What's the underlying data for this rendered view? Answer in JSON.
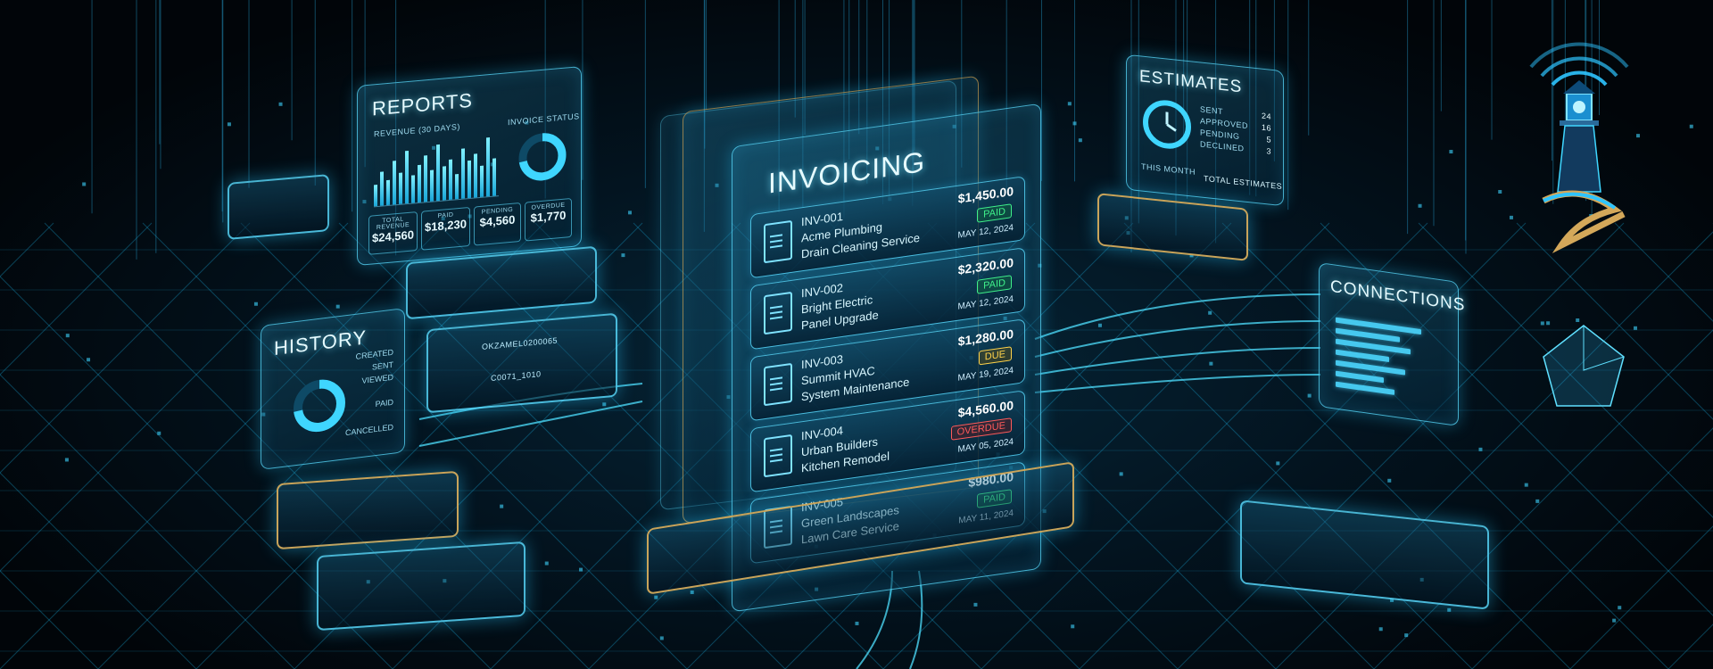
{
  "reports": {
    "title": "REPORTS",
    "revenue_label": "REVENUE (30 DAYS)",
    "status_label": "INVOICE STATUS",
    "bars": [
      0.35,
      0.55,
      0.4,
      0.7,
      0.5,
      0.85,
      0.45,
      0.6,
      0.75,
      0.5,
      0.9,
      0.55,
      0.65,
      0.4,
      0.8,
      0.6,
      0.7,
      0.5,
      0.95,
      0.6
    ],
    "stats": [
      {
        "label": "TOTAL REVENUE",
        "value": "$24,560"
      },
      {
        "label": "PAID",
        "value": "$18,230"
      },
      {
        "label": "PENDING",
        "value": "$4,560"
      },
      {
        "label": "OVERDUE",
        "value": "$1,770"
      }
    ]
  },
  "history": {
    "title": "HISTORY",
    "items": [
      "CREATED",
      "SENT",
      "VIEWED",
      "",
      "PAID",
      "",
      "CANCELLED"
    ]
  },
  "invoicing": {
    "title": "INVOICING",
    "invoices": [
      {
        "id": "INV-001",
        "client": "Acme Plumbing",
        "desc": "Drain Cleaning Service",
        "amount": "$1,450.00",
        "status": "PAID",
        "status_type": "paid",
        "date": "MAY 12, 2024"
      },
      {
        "id": "INV-002",
        "client": "Bright Electric",
        "desc": "Panel Upgrade",
        "amount": "$2,320.00",
        "status": "PAID",
        "status_type": "paid",
        "date": "MAY 12, 2024"
      },
      {
        "id": "INV-003",
        "client": "Summit HVAC",
        "desc": "System Maintenance",
        "amount": "$1,280.00",
        "status": "DUE",
        "status_type": "due",
        "date": "MAY 19, 2024"
      },
      {
        "id": "INV-004",
        "client": "Urban Builders",
        "desc": "Kitchen Remodel",
        "amount": "$4,560.00",
        "status": "OVERDUE",
        "status_type": "overdue",
        "date": "MAY 05, 2024"
      },
      {
        "id": "INV-005",
        "client": "Green Landscapes",
        "desc": "Lawn Care Service",
        "amount": "$980.00",
        "status": "PAID",
        "status_type": "paid",
        "date": "MAY 11, 2024"
      }
    ]
  },
  "estimates": {
    "title": "ESTIMATES",
    "rows": [
      {
        "label": "SENT",
        "value": "24"
      },
      {
        "label": "APPROVED",
        "value": "16"
      },
      {
        "label": "PENDING",
        "value": "5"
      },
      {
        "label": "DECLINED",
        "value": "3"
      }
    ],
    "footer_left": "THIS MONTH",
    "footer_right": "TOTAL ESTIMATES"
  },
  "connections": {
    "title": "CONNECTIONS",
    "bars": [
      0.8,
      0.6,
      0.7,
      0.5,
      0.65,
      0.45,
      0.55
    ]
  },
  "chip_labels": [
    "OKZAMEL0200065",
    "C0071_1010"
  ],
  "colors": {
    "accent": "#3fd6ff",
    "paid": "#3ff08a",
    "due": "#ffd34a",
    "overdue": "#ff5a5a",
    "gold": "#c9a45a"
  }
}
